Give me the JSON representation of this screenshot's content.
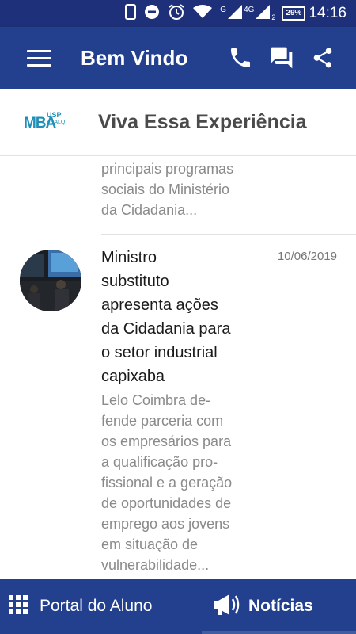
{
  "status_bar": {
    "time": "14:16",
    "battery": "29%",
    "network_label": "4G",
    "signal_g": "G",
    "sim2": "2",
    "icons": [
      "phone-outline-icon",
      "do-not-disturb-icon",
      "alarm-icon",
      "wifi-icon",
      "signal-icon",
      "battery-icon"
    ]
  },
  "app_bar": {
    "title": "Bem Vindo",
    "icons": [
      "menu-icon",
      "phone-icon",
      "chat-icon",
      "share-icon"
    ]
  },
  "brand": {
    "logo_main": "MBA",
    "logo_top": "USP",
    "logo_bottom": "ESALQ",
    "slogan": "Viva Essa Experiência"
  },
  "news": {
    "items": [
      {
        "desc_lines": [
          "principais programas",
          "sociais do Ministério",
          "da Cidadania..."
        ]
      },
      {
        "headline_lines": [
          "Ministro",
          "substituto",
          "apresenta ações",
          "da Cidadania para",
          "o setor industrial",
          "capixaba"
        ],
        "date": "10/06/2019",
        "desc_lines": [
          "Lelo Coimbra de-",
          "fende parceria com",
          "os empresários para",
          "a qualificação pro-",
          "fissional e a geração",
          "de oportunidades de",
          "emprego aos jovens",
          "em situação de",
          "vulnerabilidade..."
        ]
      }
    ]
  },
  "bottom_nav": {
    "tabs": [
      {
        "label": "Portal do Aluno",
        "icon": "grid-icon",
        "active": false
      },
      {
        "label": "Notícias",
        "icon": "megaphone-icon",
        "active": true
      }
    ]
  },
  "colors": {
    "primary": "#23408e",
    "status_bar": "#1d3079",
    "logo": "#1e8fb8",
    "text_muted": "#8a8a8a"
  }
}
